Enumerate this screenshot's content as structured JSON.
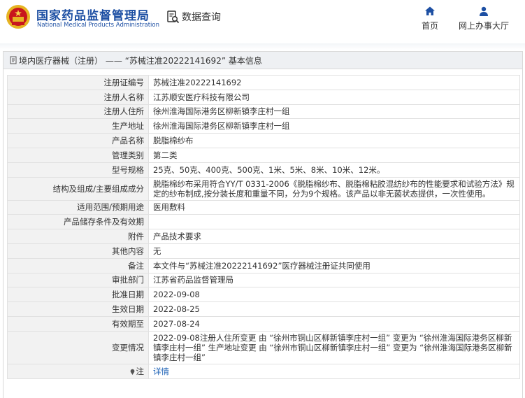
{
  "header": {
    "title_cn": "国家药品监督管理局",
    "title_en": "National Medical Products Administration",
    "query_label": "数据查询",
    "nav": [
      {
        "label": "首页",
        "icon": "home-icon"
      },
      {
        "label": "网上办事大厅",
        "icon": "user-icon"
      }
    ]
  },
  "breadcrumb": "境内医疗器械（注册） —— “苏械注准20222141692” 基本信息",
  "rows": [
    {
      "label": "注册证编号",
      "value": "苏械注准20222141692"
    },
    {
      "label": "注册人名称",
      "value": "江苏顺安医疗科技有限公司"
    },
    {
      "label": "注册人住所",
      "value": "徐州淮海国际港务区柳新镇李庄村一组"
    },
    {
      "label": "生产地址",
      "value": "徐州淮海国际港务区柳新镇李庄村一组"
    },
    {
      "label": "产品名称",
      "value": "脱脂棉纱布"
    },
    {
      "label": "管理类别",
      "value": "第二类"
    },
    {
      "label": "型号规格",
      "value": "25克、50克、400克、500克、1米、5米、8米、10米、12米。"
    },
    {
      "label": "结构及组成/主要组成成分",
      "value": "脱脂棉纱布采用符合YY/T 0331-2006《脱脂棉纱布、脱脂棉粘胶混纺纱布的性能要求和试验方法》规定的纱布制成,按分装长度和重量不同，分为9个规格。该产品以非无菌状态提供，一次性使用。"
    },
    {
      "label": "适用范围/预期用途",
      "value": "医用敷料"
    },
    {
      "label": "产品储存条件及有效期",
      "value": ""
    },
    {
      "label": "附件",
      "value": "产品技术要求"
    },
    {
      "label": "其他内容",
      "value": "无"
    },
    {
      "label": "备注",
      "value": "本文件与“苏械注准20222141692”医疗器械注册证共同使用"
    },
    {
      "label": "审批部门",
      "value": "江苏省药品监督管理局"
    },
    {
      "label": "批准日期",
      "value": "2022-09-08"
    },
    {
      "label": "生效日期",
      "value": "2022-08-25"
    },
    {
      "label": "有效期至",
      "value": "2027-08-24"
    },
    {
      "label": "变更情况",
      "value": "2022-09-08注册人住所变更 由 “徐州市铜山区柳新镇李庄村一组” 变更为 “徐州淮海国际港务区柳新镇李庄村一组” 生产地址变更 由 “徐州市铜山区柳新镇李庄村一组” 变更为 “徐州淮海国际港务区柳新镇李庄村一组”"
    }
  ],
  "note": {
    "label": "注",
    "link": "详情"
  }
}
